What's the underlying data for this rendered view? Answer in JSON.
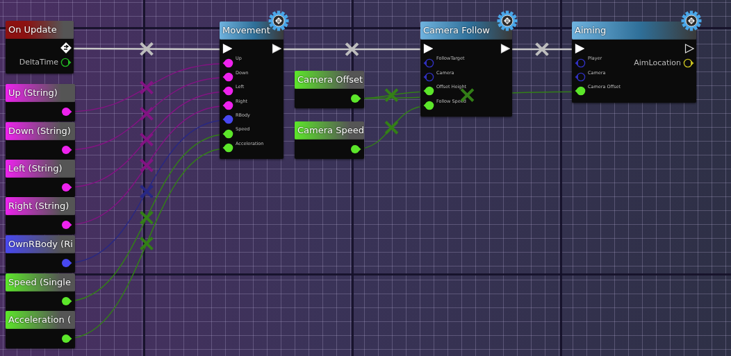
{
  "nodes": [
    {
      "kind": "event",
      "title": "On Update",
      "color": "#8c1111",
      "outputs": [
        {
          "kind": "event",
          "connected": true
        },
        {
          "kind": "data",
          "label": "DeltaTime",
          "color": "#22b822",
          "connected": false
        }
      ]
    },
    {
      "kind": "variable",
      "title": "Up (String)",
      "color": "#ee22ee"
    },
    {
      "kind": "variable",
      "title": "Down (String)",
      "color": "#ee22ee"
    },
    {
      "kind": "variable",
      "title": "Left (String)",
      "color": "#ee22ee"
    },
    {
      "kind": "variable",
      "title": "Right (String)",
      "color": "#ee22ee"
    },
    {
      "kind": "variable",
      "title": "OwnRBody (Ri",
      "color": "#4848f0"
    },
    {
      "kind": "variable",
      "title": "Speed (Single",
      "color": "#5ce62a"
    },
    {
      "kind": "variable",
      "title": "Acceleration (",
      "color": "#5ce62a"
    },
    {
      "kind": "function",
      "title": "Movement",
      "inputs": [
        {
          "kind": "exec",
          "connected": true
        },
        {
          "kind": "data",
          "label": "Up",
          "color": "#ee22ee",
          "connected": true
        },
        {
          "kind": "data",
          "label": "Down",
          "color": "#ee22ee",
          "connected": true
        },
        {
          "kind": "data",
          "label": "Left",
          "color": "#ee22ee",
          "connected": true
        },
        {
          "kind": "data",
          "label": "Right",
          "color": "#ee22ee",
          "connected": true
        },
        {
          "kind": "data",
          "label": "RBody",
          "color": "#4848f0",
          "connected": true
        },
        {
          "kind": "data",
          "label": "Speed",
          "color": "#5ce62a",
          "connected": true
        },
        {
          "kind": "data",
          "label": "Acceleration",
          "color": "#5ce62a",
          "connected": true
        }
      ],
      "outputs": [
        {
          "kind": "exec",
          "connected": true
        }
      ]
    },
    {
      "kind": "variable",
      "title": "Camera Offset",
      "color": "#5ce62a"
    },
    {
      "kind": "variable",
      "title": "Camera Speed",
      "color": "#5ce62a"
    },
    {
      "kind": "function",
      "title": "Camera Follow",
      "inputs": [
        {
          "kind": "exec",
          "connected": true
        },
        {
          "kind": "data",
          "label": "FollowTarget",
          "color": "#3030c0",
          "connected": false
        },
        {
          "kind": "data",
          "label": "Camera",
          "color": "#3030c0",
          "connected": false
        },
        {
          "kind": "data",
          "label": "Offset Height",
          "color": "#5ce62a",
          "connected": true
        },
        {
          "kind": "data",
          "label": "Follow Speed",
          "color": "#5ce62a",
          "connected": true
        }
      ],
      "outputs": [
        {
          "kind": "exec",
          "connected": true
        }
      ]
    },
    {
      "kind": "function",
      "title": "Aiming",
      "inputs": [
        {
          "kind": "exec",
          "connected": true
        },
        {
          "kind": "data",
          "label": "Player",
          "color": "#3030c0",
          "connected": false
        },
        {
          "kind": "data",
          "label": "Camera",
          "color": "#3030c0",
          "connected": false
        },
        {
          "kind": "data",
          "label": "Camera Offset",
          "color": "#5ce62a",
          "connected": true
        }
      ],
      "outputs": [
        {
          "kind": "exec",
          "connected": false
        },
        {
          "kind": "data",
          "label": "AimLocation",
          "color": "#c8c020",
          "connected": false
        }
      ]
    }
  ]
}
